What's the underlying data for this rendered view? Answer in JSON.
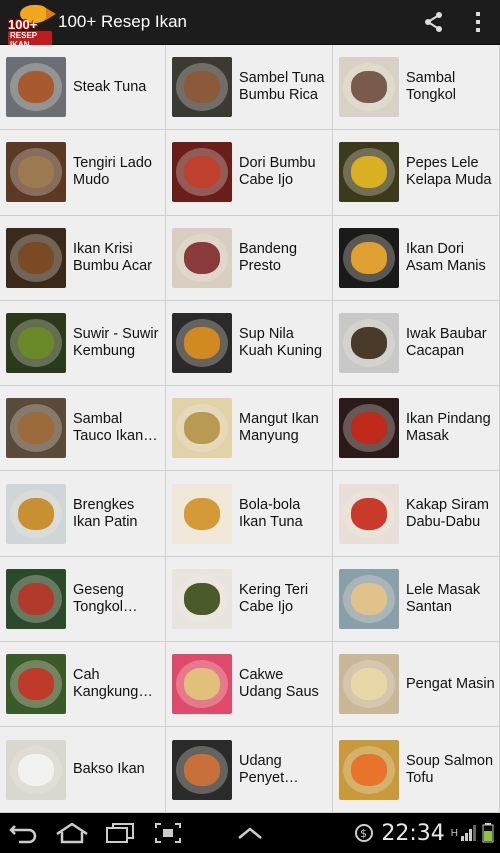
{
  "app": {
    "title": "100+ Resep Ikan",
    "logo_number": "100+",
    "logo_sub": "RESEP IKAN"
  },
  "actionbar": {
    "share_icon": "share-icon",
    "overflow_icon": "overflow-menu-icon"
  },
  "recipes": [
    {
      "label": "Steak Tuna",
      "c1": "#6b6f74",
      "c2": "#a85a2f"
    },
    {
      "label": "Sambel Tuna Bumbu Rica",
      "c1": "#3a3a32",
      "c2": "#8a5a3a"
    },
    {
      "label": "Sambal Tongkol",
      "c1": "#d8d2c6",
      "c2": "#7a5a4a"
    },
    {
      "label": "Tengiri Lado Mudo",
      "c1": "#5a3a24",
      "c2": "#9c7a52"
    },
    {
      "label": "Dori Bumbu Cabe Ijo",
      "c1": "#6a1e1a",
      "c2": "#c0402e"
    },
    {
      "label": "Pepes Lele Kelapa Muda",
      "c1": "#3b3a1a",
      "c2": "#d9b021"
    },
    {
      "label": "Ikan Krisi Bumbu Acar",
      "c1": "#3b2a1a",
      "c2": "#7a4a22"
    },
    {
      "label": "Bandeng Presto",
      "c1": "#d8cfc0",
      "c2": "#8a3a3a"
    },
    {
      "label": "Ikan Dori Asam Manis",
      "c1": "#1a1a1a",
      "c2": "#e0a030"
    },
    {
      "label": "Suwir - Suwir Kembung",
      "c1": "#2a3a1a",
      "c2": "#6a8a2a"
    },
    {
      "label": "Sup Nila Kuah Kuning",
      "c1": "#2a2a2a",
      "c2": "#d08a20"
    },
    {
      "label": "Iwak Baubar Cacapan",
      "c1": "#c8c8c8",
      "c2": "#4a3a2a"
    },
    {
      "label": "Sambal Tauco Ikan Tongkol",
      "c1": "#5a4a3a",
      "c2": "#9a6a3a"
    },
    {
      "label": "Mangut Ikan Manyung",
      "c1": "#e2d2a8",
      "c2": "#b89a52"
    },
    {
      "label": "Ikan Pindang Masak",
      "c1": "#2a1a1a",
      "c2": "#c02a1a"
    },
    {
      "label": "Brengkes Ikan Patin",
      "c1": "#d0d6d8",
      "c2": "#c89030"
    },
    {
      "label": "Bola-bola Ikan Tuna",
      "c1": "#f0e8d8",
      "c2": "#d49a3a"
    },
    {
      "label": "Kakap Siram Dabu-Dabu",
      "c1": "#e8e0d8",
      "c2": "#c83a2a"
    },
    {
      "label": "Geseng Tongkol Kemangi",
      "c1": "#2a4a2a",
      "c2": "#b23a2a"
    },
    {
      "label": "Kering Teri Cabe Ijo",
      "c1": "#e8e4de",
      "c2": "#4a5a2a"
    },
    {
      "label": "Lele Masak Santan",
      "c1": "#8aa0a8",
      "c2": "#e0c28a"
    },
    {
      "label": "Cah Kangkung Ikan Asin",
      "c1": "#3a5a2a",
      "c2": "#c03a2a"
    },
    {
      "label": "Cakwe Udang Saus",
      "c1": "#e04a6a",
      "c2": "#e0c07a"
    },
    {
      "label": "Pengat Masin",
      "c1": "#c8b898",
      "c2": "#e8d8a8"
    },
    {
      "label": "Bakso Ikan",
      "c1": "#d8d8d0",
      "c2": "#f2f2ee"
    },
    {
      "label": "Udang Penyet Sambal",
      "c1": "#2a2a2a",
      "c2": "#c8703a"
    },
    {
      "label": "Soup Salmon Tofu",
      "c1": "#c89a3a",
      "c2": "#e8742a"
    }
  ],
  "statusbar": {
    "time": "22:34",
    "network": "H"
  },
  "nav": {
    "back_icon": "back-icon",
    "home_icon": "home-icon",
    "recents_icon": "recent-apps-icon",
    "screenshot_icon": "screenshot-icon",
    "menu_icon": "menu-up-icon"
  }
}
